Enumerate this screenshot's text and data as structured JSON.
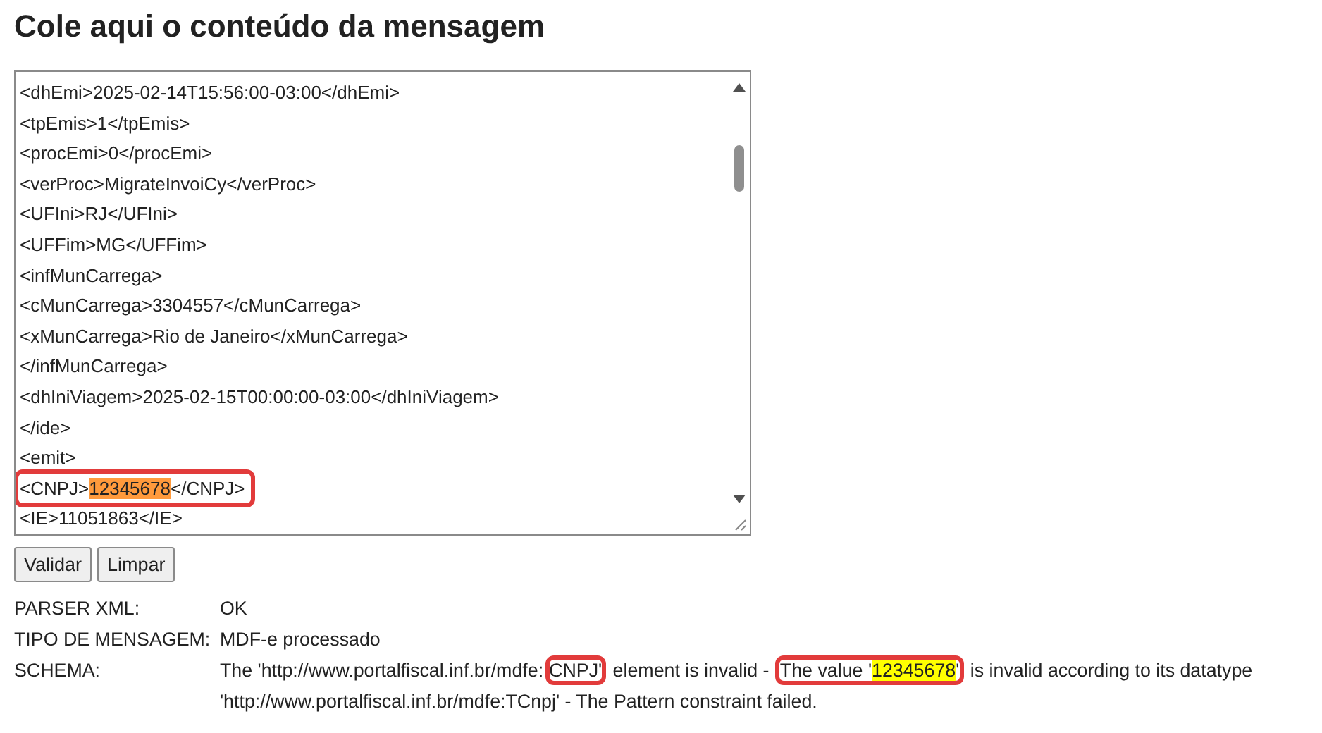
{
  "title": "Cole aqui o conteúdo da mensagem",
  "editor": {
    "lines": [
      {
        "boxed": false,
        "parts": [
          {
            "text": "<dhEmi>2025-02-14T15:56:00-03:00</dhEmi>",
            "highlight": false
          }
        ]
      },
      {
        "boxed": false,
        "parts": [
          {
            "text": "<tpEmis>1</tpEmis>",
            "highlight": false
          }
        ]
      },
      {
        "boxed": false,
        "parts": [
          {
            "text": "<procEmi>0</procEmi>",
            "highlight": false
          }
        ]
      },
      {
        "boxed": false,
        "parts": [
          {
            "text": "<verProc>MigrateInvoiCy</verProc>",
            "highlight": false
          }
        ]
      },
      {
        "boxed": false,
        "parts": [
          {
            "text": "<UFIni>RJ</UFIni>",
            "highlight": false
          }
        ]
      },
      {
        "boxed": false,
        "parts": [
          {
            "text": "<UFFim>MG</UFFim>",
            "highlight": false
          }
        ]
      },
      {
        "boxed": false,
        "parts": [
          {
            "text": "<infMunCarrega>",
            "highlight": false
          }
        ]
      },
      {
        "boxed": false,
        "parts": [
          {
            "text": "<cMunCarrega>3304557</cMunCarrega>",
            "highlight": false
          }
        ]
      },
      {
        "boxed": false,
        "parts": [
          {
            "text": "<xMunCarrega>Rio de Janeiro</xMunCarrega>",
            "highlight": false
          }
        ]
      },
      {
        "boxed": false,
        "parts": [
          {
            "text": "</infMunCarrega>",
            "highlight": false
          }
        ]
      },
      {
        "boxed": false,
        "parts": [
          {
            "text": "<dhIniViagem>2025-02-15T00:00:00-03:00</dhIniViagem>",
            "highlight": false
          }
        ]
      },
      {
        "boxed": false,
        "parts": [
          {
            "text": "</ide>",
            "highlight": false
          }
        ]
      },
      {
        "boxed": false,
        "parts": [
          {
            "text": "<emit>",
            "highlight": false
          }
        ]
      },
      {
        "boxed": true,
        "parts": [
          {
            "text": "<CNPJ>",
            "highlight": false
          },
          {
            "text": "12345678",
            "highlight": true
          },
          {
            "text": "</CNPJ>",
            "highlight": false
          }
        ]
      },
      {
        "boxed": false,
        "parts": [
          {
            "text": "<IE>11051863</IE>",
            "highlight": false
          }
        ]
      }
    ]
  },
  "buttons": [
    "Validar",
    "Limpar"
  ],
  "results": [
    {
      "label": "PARSER XML:",
      "segments": [
        {
          "boxed": false,
          "parts": [
            {
              "text": "OK",
              "highlight": false
            }
          ]
        }
      ]
    },
    {
      "label": "TIPO DE MENSAGEM:",
      "segments": [
        {
          "boxed": false,
          "parts": [
            {
              "text": "MDF-e processado",
              "highlight": false
            }
          ]
        }
      ]
    },
    {
      "label": "SCHEMA:",
      "segments": [
        {
          "boxed": false,
          "parts": [
            {
              "text": "The 'http://www.portalfiscal.inf.br/mdfe:",
              "highlight": false
            }
          ]
        },
        {
          "boxed": true,
          "parts": [
            {
              "text": "CNPJ'",
              "highlight": false
            }
          ]
        },
        {
          "boxed": false,
          "parts": [
            {
              "text": " element is invalid - ",
              "highlight": false
            }
          ]
        },
        {
          "boxed": true,
          "parts": [
            {
              "text": "The value '",
              "highlight": false
            },
            {
              "text": "12345678",
              "highlight": true
            },
            {
              "text": "'",
              "highlight": false
            }
          ]
        },
        {
          "boxed": false,
          "parts": [
            {
              "text": " is invalid according to its datatype 'http://www.portalfiscal.inf.br/mdfe:TCnpj' - The Pattern constraint failed.",
              "highlight": false
            }
          ]
        }
      ]
    }
  ]
}
